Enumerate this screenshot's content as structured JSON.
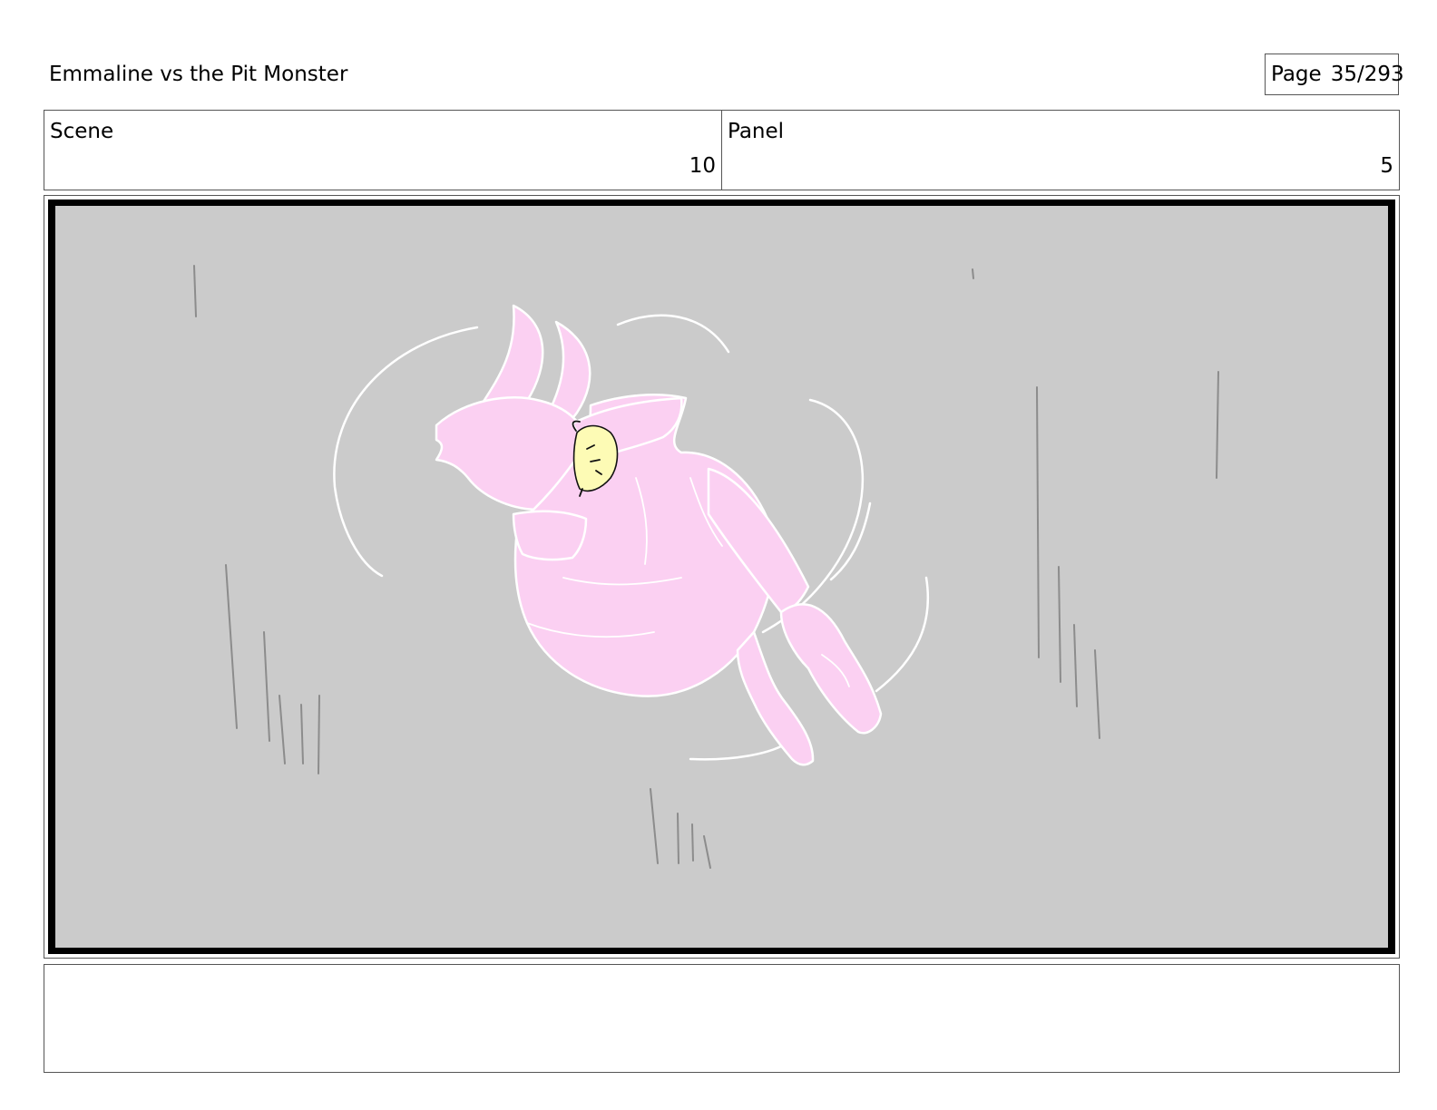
{
  "header": {
    "title": "Emmaline vs the Pit Monster",
    "page_label": "Page",
    "page_number": "35/293"
  },
  "info": {
    "scene_label": "Scene",
    "scene_value": "10",
    "panel_label": "Panel",
    "panel_value": "5"
  },
  "panel": {
    "background_color": "#cbcbcb",
    "figure_color": "#fbd0f2",
    "face_color": "#fdfbb5",
    "line_color": "#ffffff",
    "speed_line_color": "#8c8c8c"
  },
  "notes": {
    "text": ""
  }
}
